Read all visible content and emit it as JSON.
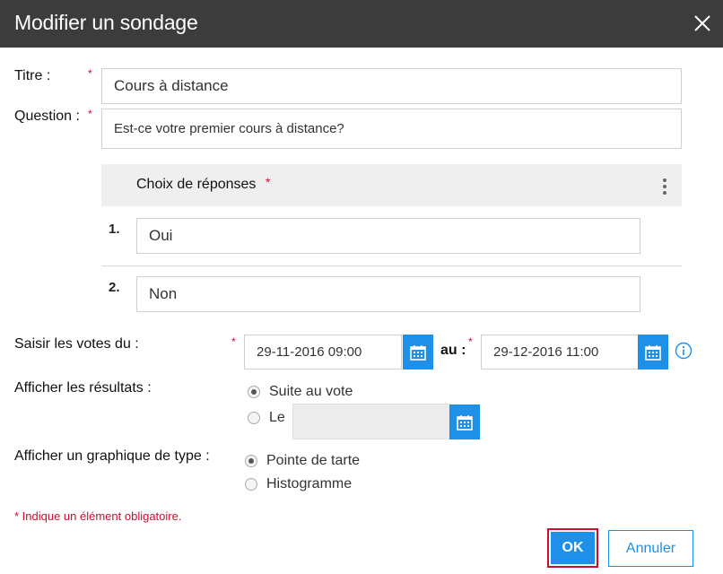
{
  "dialog": {
    "title": "Modifier un sondage",
    "close_icon": "close-icon"
  },
  "form": {
    "required_mark": "*",
    "titre": {
      "label": "Titre :",
      "value": "Cours à distance"
    },
    "question": {
      "label": "Question :",
      "value": "Est-ce votre premier cours à distance?"
    },
    "choices": {
      "header": "Choix de réponses",
      "menu_icon": "kebab-menu-icon",
      "items": [
        {
          "number": "1.",
          "value": "Oui"
        },
        {
          "number": "2.",
          "value": "Non"
        }
      ]
    },
    "votes": {
      "label": "Saisir les votes du :",
      "from_value": "29-11-2016 09:00",
      "to_label": "au :",
      "to_value": "29-12-2016 11:00",
      "calendar_icon": "calendar-icon",
      "info_icon": "info-icon"
    },
    "results": {
      "label": "Afficher les résultats :",
      "options": [
        {
          "label": "Suite au vote",
          "checked": true
        },
        {
          "label": "Le",
          "checked": false
        }
      ],
      "date_value": ""
    },
    "chart": {
      "label": "Afficher un graphique de type :",
      "options": [
        {
          "label": "Pointe de tarte",
          "checked": true
        },
        {
          "label": "Histogramme",
          "checked": false
        }
      ]
    },
    "required_note": "* Indique un élément obligatoire."
  },
  "buttons": {
    "ok": "OK",
    "cancel": "Annuler"
  },
  "colors": {
    "titlebar": "#3c3c3c",
    "accent": "#1e90e8",
    "required": "#c8102e"
  }
}
